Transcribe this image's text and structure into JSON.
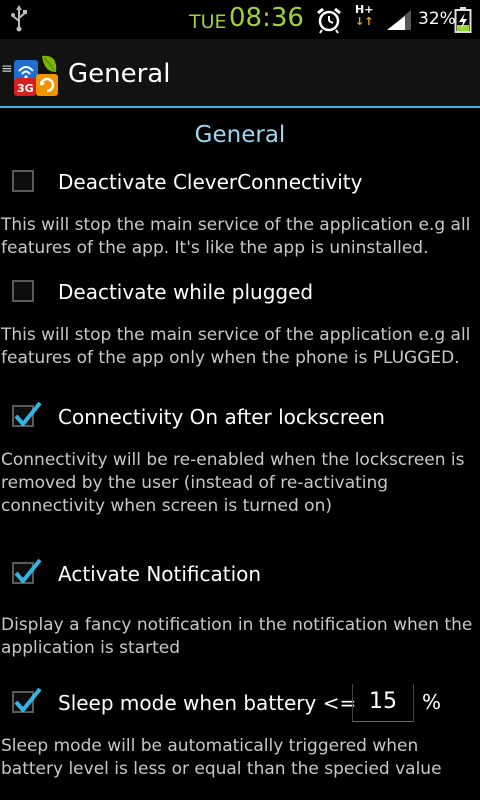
{
  "status_bar": {
    "day": "TUE",
    "time": "08:36",
    "network": "H+",
    "battery_pct": "32%"
  },
  "action_bar": {
    "title": "General"
  },
  "section": {
    "title": "General"
  },
  "settings": [
    {
      "label": "Deactivate CleverConnectivity",
      "checked": false,
      "description": "This will stop the main service of the application e.g all features of the app. It's like the app is uninstalled."
    },
    {
      "label": "Deactivate while plugged",
      "checked": false,
      "description": "This will stop the main service of the application e.g all features of the app only when the phone is PLUGGED."
    },
    {
      "label": "Connectivity On after lockscreen",
      "checked": true,
      "description": "Connectivity will be re-enabled when the lockscreen is removed by the user (instead of re-activating connectivity when screen is turned on)"
    },
    {
      "label": "Activate Notification",
      "checked": true,
      "description": "Display a fancy notification in the notification when the application is started"
    },
    {
      "label": "Sleep mode when battery <=",
      "checked": true,
      "value": "15",
      "unit": "%",
      "description": "Sleep mode will be automatically triggered when battery level is less or equal than the specied value"
    }
  ],
  "colors": {
    "accent": "#33b5e5",
    "clock": "#9bd33a",
    "section_title": "#9fd7f2"
  }
}
